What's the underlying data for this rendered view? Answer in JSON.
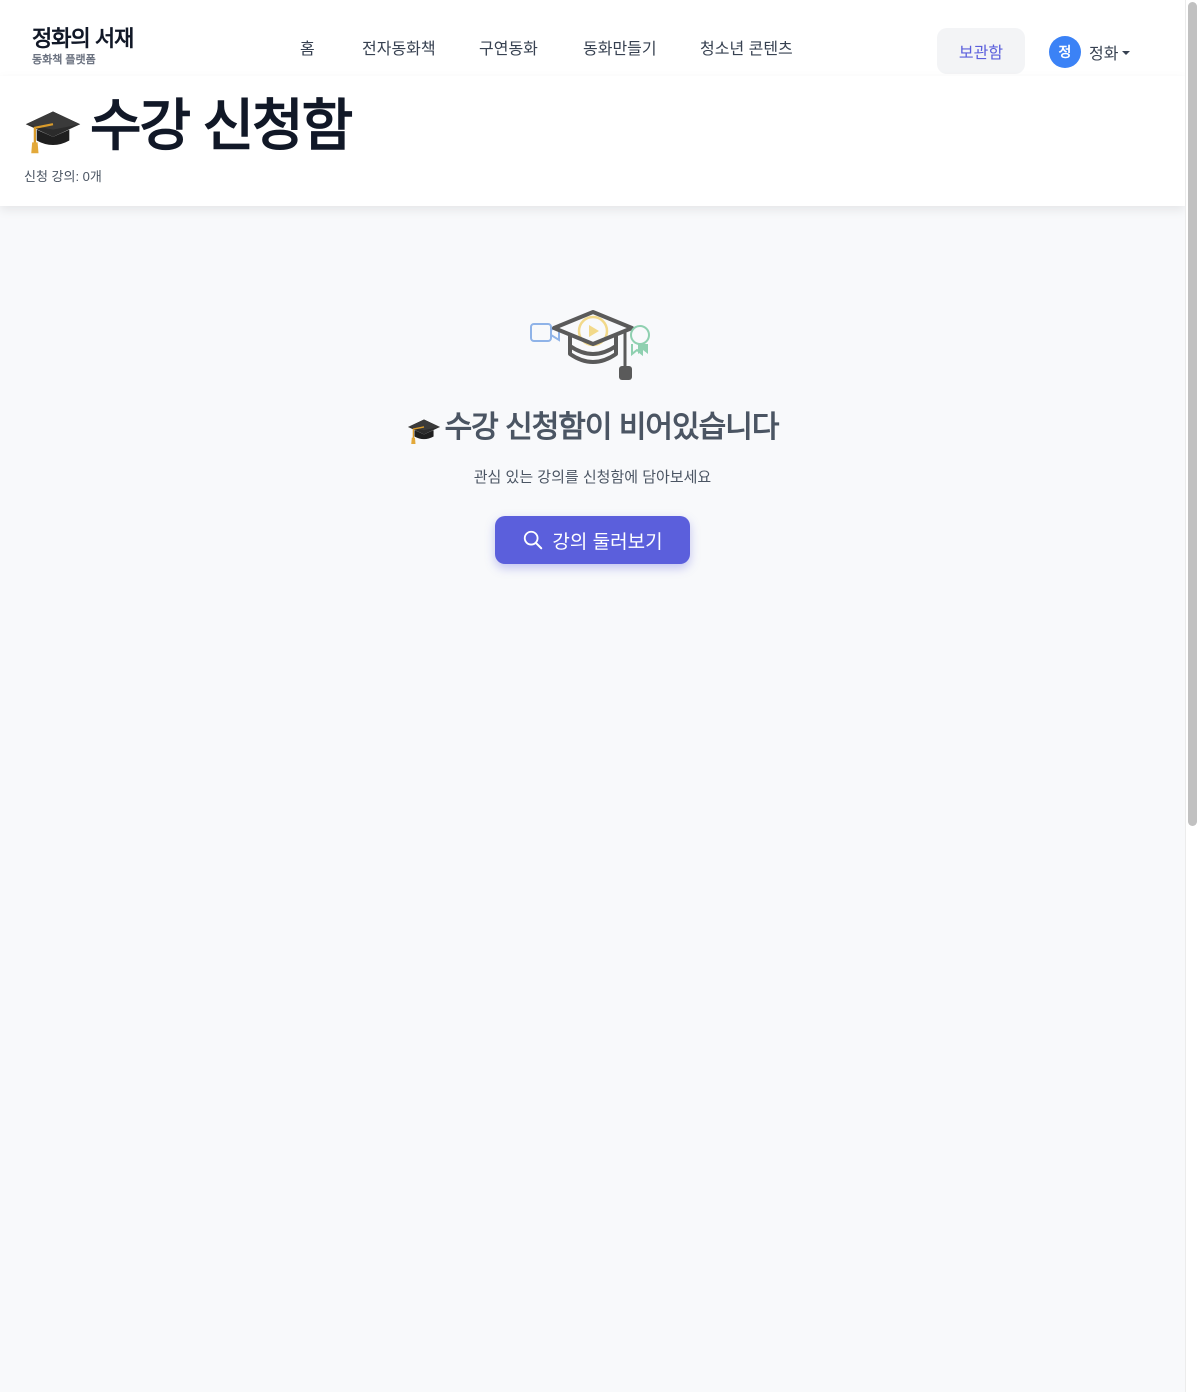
{
  "brand": {
    "title": "정화의 서재",
    "subtitle": "동화책 플랫폼"
  },
  "nav": {
    "items": [
      {
        "label": "홈"
      },
      {
        "label": "전자동화책"
      },
      {
        "label": "구연동화"
      },
      {
        "label": "동화만들기"
      },
      {
        "label": "청소년 콘텐츠"
      }
    ],
    "storage_label": "보관함",
    "user": {
      "avatar_initial": "정",
      "name": "정화"
    }
  },
  "header": {
    "title": "수강 신청함",
    "count_text": "신청 강의: 0개"
  },
  "empty": {
    "title": "수강 신청함이 비어있습니다",
    "description": "관심 있는 강의를 신청함에 담아보세요",
    "button_label": "강의 둘러보기"
  },
  "colors": {
    "accent": "#5b5fdc",
    "avatar": "#3b82f6",
    "page_bg": "#f8f9fb"
  },
  "icons": {
    "title_icon": "graduation-cap-icon",
    "empty_title_icon": "graduation-cap-icon",
    "button_icon": "search-icon"
  }
}
